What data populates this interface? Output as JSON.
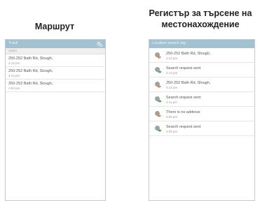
{
  "captions": {
    "left": "Маршрут",
    "right_line1": "Регистър за търсене на",
    "right_line2": "местонахождение"
  },
  "left_screen": {
    "title": "Track",
    "subheader": "Upper",
    "items": [
      {
        "title": "250-252 Bath Rd, Slough,",
        "time": "4:13 pm"
      },
      {
        "title": "250-252 Bath Rd, Slough,",
        "time": "4:13 pm"
      },
      {
        "title": "250-252 Bath Rd, Slough,",
        "time": "4:00 pm"
      }
    ]
  },
  "right_screen": {
    "title": "Location search log",
    "items": [
      {
        "title": "250-252 Bath Rd, Slough,",
        "time": "4:13 pm",
        "icon": "location-found-icon"
      },
      {
        "title": "Search request sent",
        "time": "4:13 pm",
        "icon": "request-sent-icon"
      },
      {
        "title": "250-252 Bath Rd, Slough,",
        "time": "4:12 pm",
        "icon": "location-found-icon"
      },
      {
        "title": "Search request sent",
        "time": "4:11 pm",
        "icon": "request-sent-icon"
      },
      {
        "title": "There is no address",
        "time": "4:00 pm",
        "icon": "no-address-icon"
      },
      {
        "title": "Search request sent",
        "time": "4:00 pm",
        "icon": "request-sent-icon"
      }
    ]
  },
  "colors": {
    "title_bar": "#a2c2d2",
    "found_arrow": "#e8742a",
    "sent_arrow": "#3aa64a",
    "no_address_arrow": "#e8742a"
  }
}
